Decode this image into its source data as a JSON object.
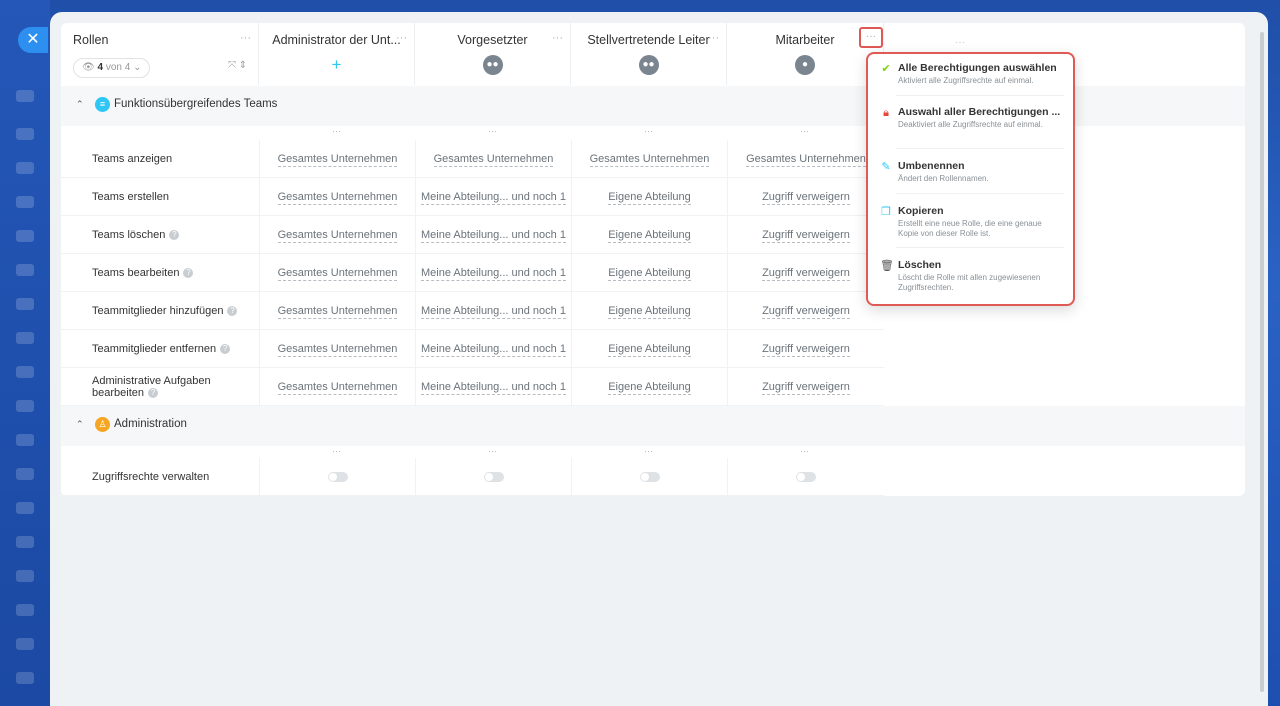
{
  "close_label": "✕",
  "header": {
    "roles_title": "Rollen",
    "roles_pill_count": "4",
    "roles_pill_of": "von 4",
    "dots": "···",
    "columns": [
      {
        "title": "Administrator der Unt..."
      },
      {
        "title": "Vorgesetzter"
      },
      {
        "title": "Stellvertretende Leiter"
      },
      {
        "title": "Mitarbeiter"
      }
    ]
  },
  "groups": [
    {
      "title": "Funktionsübergreifendes Teams",
      "rows": [
        {
          "label": "Teams anzeigen",
          "help": false,
          "cells": [
            "Gesamtes Unternehmen",
            "Gesamtes Unternehmen",
            "Gesamtes Unternehmen",
            "Gesamtes Unternehmen"
          ]
        },
        {
          "label": "Teams erstellen",
          "help": false,
          "cells": [
            "Gesamtes Unternehmen",
            "Meine Abteilung... und noch 1",
            "Eigene Abteilung",
            "Zugriff verweigern"
          ]
        },
        {
          "label": "Teams löschen",
          "help": true,
          "cells": [
            "Gesamtes Unternehmen",
            "Meine Abteilung... und noch 1",
            "Eigene Abteilung",
            "Zugriff verweigern"
          ]
        },
        {
          "label": "Teams bearbeiten",
          "help": true,
          "cells": [
            "Gesamtes Unternehmen",
            "Meine Abteilung... und noch 1",
            "Eigene Abteilung",
            "Zugriff verweigern"
          ]
        },
        {
          "label": "Teammitglieder hinzufügen",
          "help": true,
          "cells": [
            "Gesamtes Unternehmen",
            "Meine Abteilung... und noch 1",
            "Eigene Abteilung",
            "Zugriff verweigern"
          ]
        },
        {
          "label": "Teammitglieder entfernen",
          "help": true,
          "cells": [
            "Gesamtes Unternehmen",
            "Meine Abteilung... und noch 1",
            "Eigene Abteilung",
            "Zugriff verweigern"
          ]
        },
        {
          "label_line1": "Administrative Aufgaben",
          "label_line2": "bearbeiten",
          "help": true,
          "cells": [
            "Gesamtes Unternehmen",
            "Meine Abteilung... und noch 1",
            "Eigene Abteilung",
            "Zugriff verweigern"
          ]
        }
      ]
    },
    {
      "title": "Administration",
      "rows": [
        {
          "label": "Zugriffsrechte verwalten",
          "help": false,
          "toggles": [
            false,
            false,
            false,
            false
          ]
        }
      ]
    }
  ],
  "menu": {
    "items": [
      {
        "title": "Alle Berechtigungen auswählen",
        "desc": "Aktiviert alle Zugriffsrechte auf einmal.",
        "icon": "check-icon"
      },
      {
        "title": "Auswahl aller Berechtigungen ...",
        "desc": "Deaktiviert alle Zugriffsrechte auf einmal.",
        "icon": "lock-icon"
      },
      {
        "title": "Umbenennen",
        "desc": "Ändert den Rollennamen.",
        "icon": "pencil-icon"
      },
      {
        "title": "Kopieren",
        "desc": "Erstellt eine neue Rolle, die eine genaue Kopie von dieser Rolle ist.",
        "icon": "copy-icon"
      },
      {
        "title": "Löschen",
        "desc": "Löscht die Rolle mit allen zugewiesenen Zugriffsrechten.",
        "icon": "trash-icon"
      }
    ]
  },
  "colors": {
    "accent": "#2fc6f6",
    "highlight": "#e05a55",
    "check": "#7bd500",
    "lock": "#e8443a",
    "pencil": "#2fc6f6",
    "copy": "#2fc6f6"
  }
}
